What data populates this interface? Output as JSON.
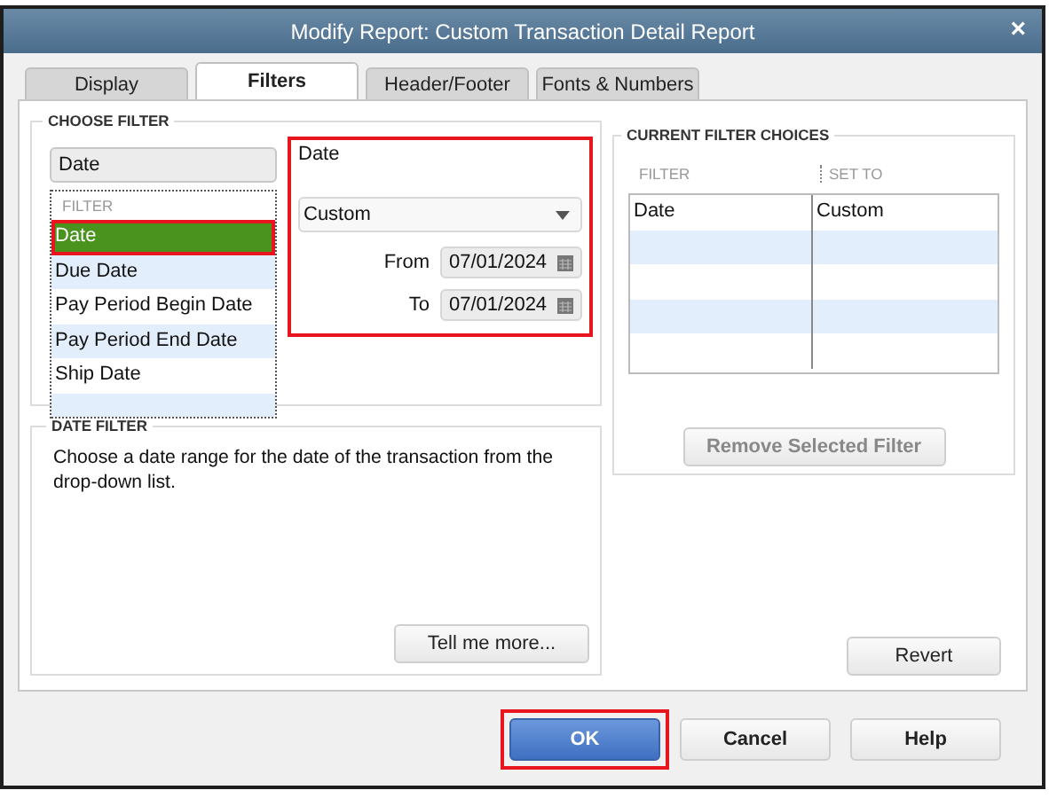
{
  "window": {
    "title": "Modify Report: Custom Transaction Detail Report",
    "close": "×"
  },
  "tabs": [
    {
      "label": "Display",
      "selected": false
    },
    {
      "label": "Filters",
      "selected": true
    },
    {
      "label": "Header/Footer",
      "selected": false
    },
    {
      "label": "Fonts & Numbers",
      "selected": false
    }
  ],
  "choose_filter": {
    "heading": "CHOOSE FILTER",
    "search_value": "Date",
    "list_header": "FILTER",
    "items": [
      {
        "label": "Date",
        "selected": true,
        "highlighted": true
      },
      {
        "label": "Due Date",
        "selected": false,
        "highlighted": false
      },
      {
        "label": "Pay Period Begin Date",
        "selected": false,
        "highlighted": false
      },
      {
        "label": "Pay Period End Date",
        "selected": false,
        "highlighted": false
      },
      {
        "label": "Ship Date",
        "selected": false,
        "highlighted": false
      }
    ],
    "detail": {
      "highlighted": true,
      "title": "Date",
      "dropdown": "Custom",
      "from_label": "From",
      "from": "07/01/2024",
      "to_label": "To",
      "to": "07/01/2024"
    }
  },
  "date_filter": {
    "heading": "DATE FILTER",
    "text": "Choose a date range for the date of the transaction from the drop-down list.",
    "button": "Tell me more..."
  },
  "current_filter_choices": {
    "heading": "CURRENT FILTER CHOICES",
    "columns": [
      "FILTER",
      "SET TO"
    ],
    "rows": [
      [
        "Date",
        "Custom"
      ]
    ],
    "remove_button": {
      "label": "Remove Selected Filter",
      "disabled": true
    }
  },
  "revert_button": "Revert",
  "buttons": [
    {
      "label": "OK",
      "kind": "primary",
      "highlighted": true
    },
    {
      "label": "Cancel",
      "kind": "normal",
      "highlighted": false
    },
    {
      "label": "Help",
      "kind": "normal",
      "highlighted": false
    }
  ]
}
